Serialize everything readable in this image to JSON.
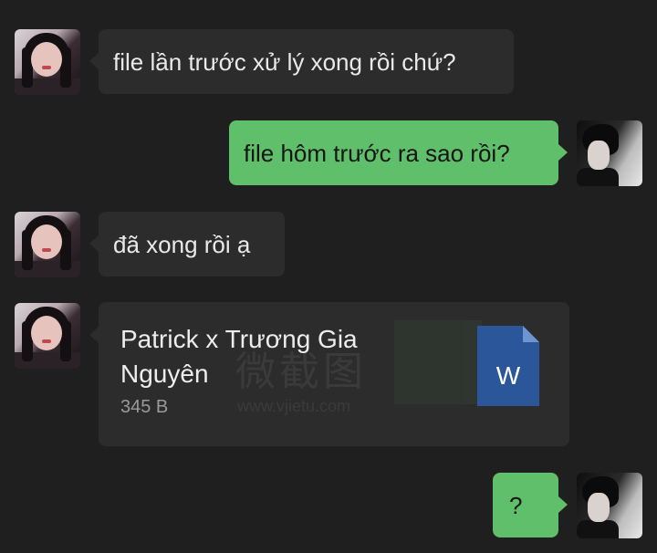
{
  "messages": [
    {
      "side": "in",
      "text": "file lần trước xử lý xong rồi chứ?"
    },
    {
      "side": "out",
      "text": "file hôm trước ra sao rồi?"
    },
    {
      "side": "in",
      "text": "đã xong rồi ạ"
    },
    {
      "side": "in",
      "type": "file",
      "file_name": "Patrick x Trương Gia Nguyên",
      "file_size": "345 B",
      "file_icon": "word-doc-icon",
      "file_icon_letter": "W",
      "watermark_text": "微截图",
      "watermark_url": "www.vjietu.com"
    },
    {
      "side": "out",
      "text": "?"
    }
  ],
  "colors": {
    "background": "#1f1f1f",
    "incoming_bubble": "#2c2c2c",
    "outgoing_bubble": "#5fbf6a",
    "word_blue": "#2b579a"
  }
}
